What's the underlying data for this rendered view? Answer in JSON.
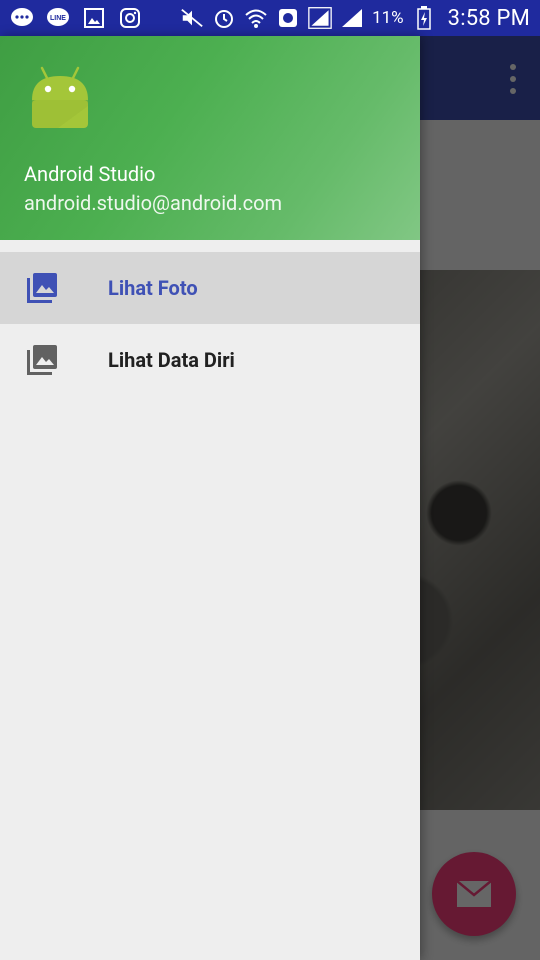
{
  "status_bar": {
    "battery_percent": "11%",
    "time": "3:58 PM",
    "icons": [
      "chat-bubble-icon",
      "line-icon",
      "gallery-icon",
      "instagram-icon",
      "mute-icon",
      "alarm-icon",
      "wifi-icon",
      "vpn-globe-icon",
      "signal-icon",
      "signal-icon",
      "battery-charging-icon"
    ]
  },
  "drawer": {
    "header": {
      "name": "Android Studio",
      "email": "android.studio@android.com"
    },
    "items": [
      {
        "label": "Lihat Foto",
        "icon": "photo-library-icon",
        "selected": true
      },
      {
        "label": "Lihat Data Diri",
        "icon": "photo-library-icon",
        "selected": false
      }
    ]
  },
  "colors": {
    "status_bar": "#1f2a9e",
    "app_bar": "#3f51b5",
    "accent": "#ff4081",
    "header_green": "#4caf50",
    "selected_text": "#3f51b5"
  }
}
